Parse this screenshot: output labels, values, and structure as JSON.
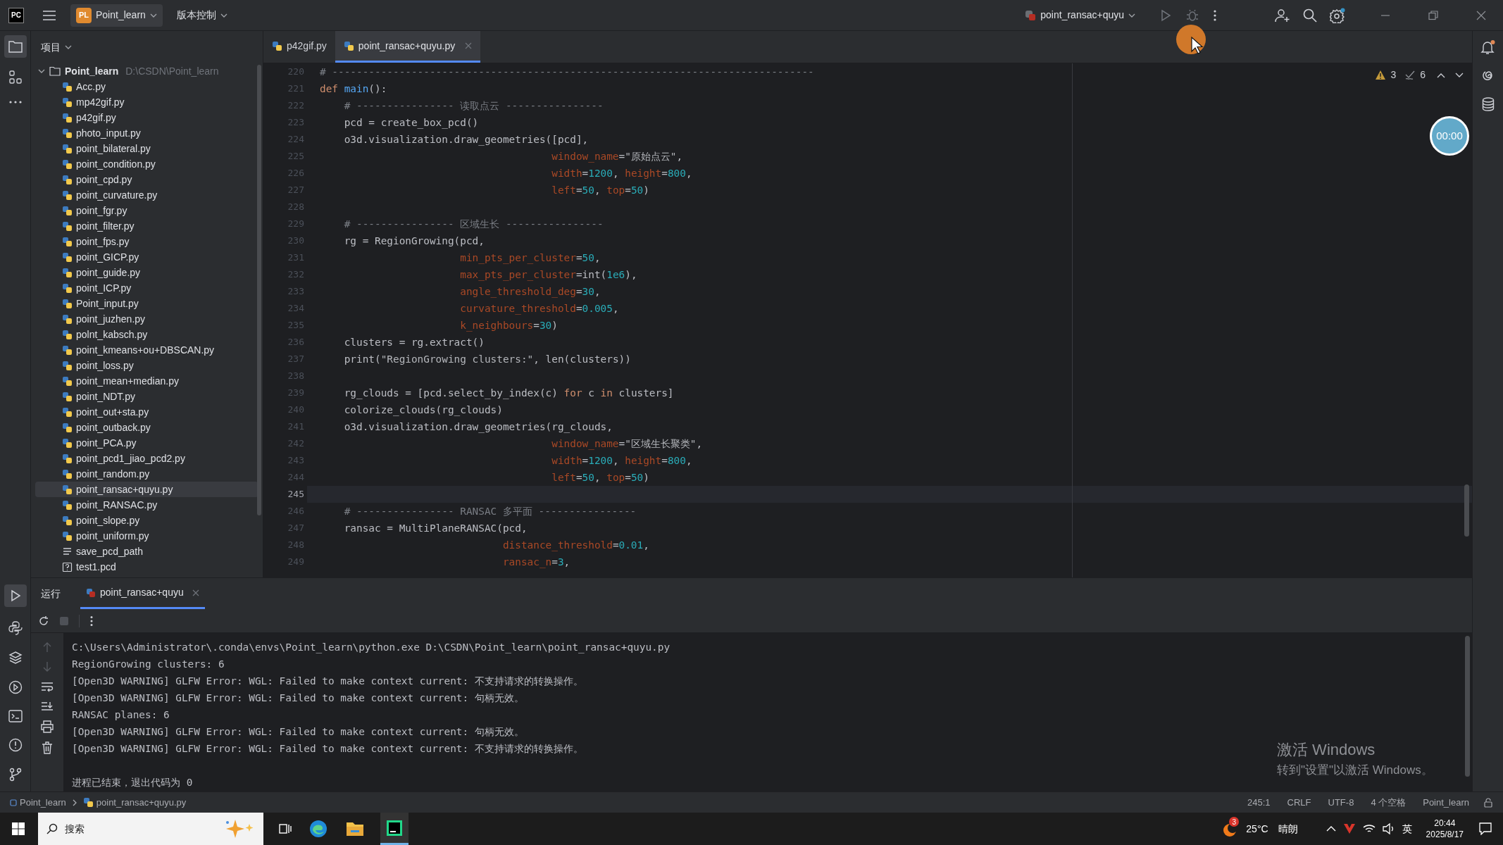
{
  "title_bar": {
    "app_logo": "PC",
    "project": {
      "badge": "PL",
      "name": "Point_learn"
    },
    "vcs_menu": "版本控制",
    "run_config": "point_ransac+quyu"
  },
  "project_panel": {
    "title": "项目",
    "root": {
      "name": "Point_learn",
      "path": "D:\\CSDN\\Point_learn",
      "expanded": true,
      "children": [
        {
          "name": "Acc.py",
          "kind": "python",
          "selected": false
        },
        {
          "name": "mp42gif.py",
          "kind": "python",
          "selected": false
        },
        {
          "name": "p42gif.py",
          "kind": "python",
          "selected": false
        },
        {
          "name": "photo_input.py",
          "kind": "python",
          "selected": false
        },
        {
          "name": "point_bilateral.py",
          "kind": "python",
          "selected": false
        },
        {
          "name": "point_condition.py",
          "kind": "python",
          "selected": false
        },
        {
          "name": "point_cpd.py",
          "kind": "python",
          "selected": false
        },
        {
          "name": "point_curvature.py",
          "kind": "python",
          "selected": false
        },
        {
          "name": "point_fgr.py",
          "kind": "python",
          "selected": false
        },
        {
          "name": "point_filter.py",
          "kind": "python",
          "selected": false
        },
        {
          "name": "point_fps.py",
          "kind": "python",
          "selected": false
        },
        {
          "name": "point_GICP.py",
          "kind": "python",
          "selected": false
        },
        {
          "name": "point_guide.py",
          "kind": "python",
          "selected": false
        },
        {
          "name": "point_ICP.py",
          "kind": "python",
          "selected": false
        },
        {
          "name": "Point_input.py",
          "kind": "python",
          "selected": false
        },
        {
          "name": "point_juzhen.py",
          "kind": "python",
          "selected": false
        },
        {
          "name": "polnt_kabsch.py",
          "kind": "python",
          "selected": false
        },
        {
          "name": "point_kmeans+ou+DBSCAN.py",
          "kind": "python",
          "selected": false
        },
        {
          "name": "point_loss.py",
          "kind": "python",
          "selected": false
        },
        {
          "name": "point_mean+median.py",
          "kind": "python",
          "selected": false
        },
        {
          "name": "point_NDT.py",
          "kind": "python",
          "selected": false
        },
        {
          "name": "point_out+sta.py",
          "kind": "python",
          "selected": false
        },
        {
          "name": "point_outback.py",
          "kind": "python",
          "selected": false
        },
        {
          "name": "point_PCA.py",
          "kind": "python",
          "selected": false
        },
        {
          "name": "point_pcd1_jiao_pcd2.py",
          "kind": "python",
          "selected": false
        },
        {
          "name": "point_random.py",
          "kind": "python",
          "selected": false
        },
        {
          "name": "point_ransac+quyu.py",
          "kind": "python",
          "selected": true
        },
        {
          "name": "point_RANSAC.py",
          "kind": "python",
          "selected": false
        },
        {
          "name": "point_slope.py",
          "kind": "python",
          "selected": false
        },
        {
          "name": "point_uniform.py",
          "kind": "python",
          "selected": false
        },
        {
          "name": "save_pcd_path",
          "kind": "text",
          "selected": false
        },
        {
          "name": "test1.pcd",
          "kind": "unknown",
          "selected": false
        }
      ]
    }
  },
  "editor": {
    "tabs": [
      {
        "label": "p42gif.py",
        "selected": false
      },
      {
        "label": "point_ransac+quyu.py",
        "selected": true
      }
    ],
    "inspections": {
      "warnings": "3",
      "weak_warnings": "6"
    },
    "lines": [
      {
        "number": "220",
        "current": false,
        "tokens": [
          {
            "kind": "comment",
            "text": "# -------------------------------------------------------------------------------"
          }
        ]
      },
      {
        "number": "221",
        "current": false,
        "tokens": [
          {
            "kind": "keyword",
            "text": "def"
          },
          {
            "kind": "function",
            "text": " main"
          },
          {
            "kind": "plain",
            "text": "():"
          }
        ]
      },
      {
        "number": "222",
        "current": false,
        "tokens": [
          {
            "kind": "comment",
            "text": "    # ---------------- 读取点云 ----------------"
          }
        ]
      },
      {
        "number": "223",
        "current": false,
        "tokens": [
          {
            "kind": "plain",
            "text": "    pcd = create_box_pcd()"
          }
        ]
      },
      {
        "number": "224",
        "current": false,
        "tokens": [
          {
            "kind": "plain",
            "text": "    o3d.visualization.draw_geometries([pcd],"
          }
        ]
      },
      {
        "number": "225",
        "current": false,
        "tokens": [
          {
            "kind": "param",
            "text": "                                      window_name"
          },
          {
            "kind": "plain",
            "text": "="
          },
          {
            "kind": "string",
            "text": "\"原始点云\""
          },
          {
            "kind": "plain",
            "text": ","
          }
        ]
      },
      {
        "number": "226",
        "current": false,
        "tokens": [
          {
            "kind": "param",
            "text": "                                      width"
          },
          {
            "kind": "plain",
            "text": "="
          },
          {
            "kind": "number",
            "text": "1200"
          },
          {
            "kind": "plain",
            "text": ", "
          },
          {
            "kind": "param",
            "text": "height"
          },
          {
            "kind": "plain",
            "text": "="
          },
          {
            "kind": "number",
            "text": "800"
          },
          {
            "kind": "plain",
            "text": ","
          }
        ]
      },
      {
        "number": "227",
        "current": false,
        "tokens": [
          {
            "kind": "param",
            "text": "                                      left"
          },
          {
            "kind": "plain",
            "text": "="
          },
          {
            "kind": "number",
            "text": "50"
          },
          {
            "kind": "plain",
            "text": ", "
          },
          {
            "kind": "param",
            "text": "top"
          },
          {
            "kind": "plain",
            "text": "="
          },
          {
            "kind": "number",
            "text": "50"
          },
          {
            "kind": "plain",
            "text": ")"
          }
        ]
      },
      {
        "number": "228",
        "current": false
      },
      {
        "number": "229",
        "current": false,
        "tokens": [
          {
            "kind": "comment",
            "text": "    # ---------------- 区域生长 ----------------"
          }
        ]
      },
      {
        "number": "230",
        "current": false,
        "tokens": [
          {
            "kind": "plain",
            "text": "    rg = RegionGrowing(pcd,"
          }
        ]
      },
      {
        "number": "231",
        "current": false,
        "tokens": [
          {
            "kind": "param",
            "text": "                       min_pts_per_cluster"
          },
          {
            "kind": "plain",
            "text": "="
          },
          {
            "kind": "number",
            "text": "50"
          },
          {
            "kind": "plain",
            "text": ","
          }
        ]
      },
      {
        "number": "232",
        "current": false,
        "tokens": [
          {
            "kind": "param",
            "text": "                       max_pts_per_cluster"
          },
          {
            "kind": "plain",
            "text": "=int("
          },
          {
            "kind": "number",
            "text": "1e6"
          },
          {
            "kind": "plain",
            "text": "),"
          }
        ]
      },
      {
        "number": "233",
        "current": false,
        "tokens": [
          {
            "kind": "param",
            "text": "                       angle_threshold_deg"
          },
          {
            "kind": "plain",
            "text": "="
          },
          {
            "kind": "number",
            "text": "30"
          },
          {
            "kind": "plain",
            "text": ","
          }
        ]
      },
      {
        "number": "234",
        "current": false,
        "tokens": [
          {
            "kind": "param",
            "text": "                       curvature_threshold"
          },
          {
            "kind": "plain",
            "text": "="
          },
          {
            "kind": "number",
            "text": "0.005"
          },
          {
            "kind": "plain",
            "text": ","
          }
        ]
      },
      {
        "number": "235",
        "current": false,
        "tokens": [
          {
            "kind": "param",
            "text": "                       k_neighbours"
          },
          {
            "kind": "plain",
            "text": "="
          },
          {
            "kind": "number",
            "text": "30"
          },
          {
            "kind": "plain",
            "text": ")"
          }
        ]
      },
      {
        "number": "236",
        "current": false,
        "tokens": [
          {
            "kind": "plain",
            "text": "    clusters = rg.extract()"
          }
        ]
      },
      {
        "number": "237",
        "current": false,
        "tokens": [
          {
            "kind": "plain",
            "text": "    print("
          },
          {
            "kind": "string",
            "text": "\"RegionGrowing clusters:\""
          },
          {
            "kind": "plain",
            "text": ", len(clusters))"
          }
        ]
      },
      {
        "number": "238",
        "current": false
      },
      {
        "number": "239",
        "current": false,
        "tokens": [
          {
            "kind": "plain",
            "text": "    rg_clouds = [pcd.select_by_index(c) "
          },
          {
            "kind": "keyword",
            "text": "for"
          },
          {
            "kind": "plain",
            "text": " c "
          },
          {
            "kind": "keyword",
            "text": "in"
          },
          {
            "kind": "plain",
            "text": " clusters]"
          }
        ]
      },
      {
        "number": "240",
        "current": false,
        "tokens": [
          {
            "kind": "plain",
            "text": "    colorize_clouds(rg_clouds)"
          }
        ]
      },
      {
        "number": "241",
        "current": false,
        "tokens": [
          {
            "kind": "plain",
            "text": "    o3d.visualization.draw_geometries(rg_clouds,"
          }
        ]
      },
      {
        "number": "242",
        "current": false,
        "tokens": [
          {
            "kind": "param",
            "text": "                                      window_name"
          },
          {
            "kind": "plain",
            "text": "="
          },
          {
            "kind": "string",
            "text": "\"区域生长聚类\""
          },
          {
            "kind": "plain",
            "text": ","
          }
        ]
      },
      {
        "number": "243",
        "current": false,
        "tokens": [
          {
            "kind": "param",
            "text": "                                      width"
          },
          {
            "kind": "plain",
            "text": "="
          },
          {
            "kind": "number",
            "text": "1200"
          },
          {
            "kind": "plain",
            "text": ", "
          },
          {
            "kind": "param",
            "text": "height"
          },
          {
            "kind": "plain",
            "text": "="
          },
          {
            "kind": "number",
            "text": "800"
          },
          {
            "kind": "plain",
            "text": ","
          }
        ]
      },
      {
        "number": "244",
        "current": false,
        "tokens": [
          {
            "kind": "param",
            "text": "                                      left"
          },
          {
            "kind": "plain",
            "text": "="
          },
          {
            "kind": "number",
            "text": "50"
          },
          {
            "kind": "plain",
            "text": ", "
          },
          {
            "kind": "param",
            "text": "top"
          },
          {
            "kind": "plain",
            "text": "="
          },
          {
            "kind": "number",
            "text": "50"
          },
          {
            "kind": "plain",
            "text": ")"
          }
        ]
      },
      {
        "number": "245",
        "current": true
      },
      {
        "number": "246",
        "current": false,
        "tokens": [
          {
            "kind": "comment",
            "text": "    # ---------------- RANSAC 多平面 ----------------"
          }
        ]
      },
      {
        "number": "247",
        "current": false,
        "tokens": [
          {
            "kind": "plain",
            "text": "    ransac = MultiPlaneRANSAC(pcd,"
          }
        ]
      },
      {
        "number": "248",
        "current": false,
        "tokens": [
          {
            "kind": "param",
            "text": "                              distance_threshold"
          },
          {
            "kind": "plain",
            "text": "="
          },
          {
            "kind": "number",
            "text": "0.01"
          },
          {
            "kind": "plain",
            "text": ","
          }
        ]
      },
      {
        "number": "249",
        "current": false,
        "tokens": [
          {
            "kind": "param",
            "text": "                              ransac_n"
          },
          {
            "kind": "plain",
            "text": "="
          },
          {
            "kind": "number",
            "text": "3"
          },
          {
            "kind": "plain",
            "text": ","
          }
        ]
      }
    ]
  },
  "timer": "00:00",
  "run_panel": {
    "title": "运行",
    "tabs": [
      {
        "label": "point_ransac+quyu",
        "selected": true
      }
    ],
    "console": [
      {
        "kind": "command",
        "text": "C:\\Users\\Administrator\\.conda\\envs\\Point_learn\\python.exe D:\\CSDN\\Point_learn\\point_ransac+quyu.py"
      },
      {
        "kind": "output",
        "text": "RegionGrowing clusters: 6"
      },
      {
        "kind": "output",
        "text": "[Open3D WARNING] GLFW Error: WGL: Failed to make context current: 不支持请求的转换操作。"
      },
      {
        "kind": "output",
        "text": "[Open3D WARNING] GLFW Error: WGL: Failed to make context current: 句柄无效。"
      },
      {
        "kind": "output",
        "text": "RANSAC planes: 6"
      },
      {
        "kind": "output",
        "text": "[Open3D WARNING] GLFW Error: WGL: Failed to make context current: 句柄无效。"
      },
      {
        "kind": "output",
        "text": "[Open3D WARNING] GLFW Error: WGL: Failed to make context current: 不支持请求的转换操作。"
      },
      {
        "kind": "exit",
        "text": "进程已结束，退出代码为 0"
      }
    ]
  },
  "activation_notice": {
    "title": "激活 Windows",
    "subtitle": "转到\"设置\"以激活 Windows。"
  },
  "status_bar": {
    "breadcrumbs": [
      "Point_learn",
      "point_ransac+quyu.py"
    ],
    "position": "245:1",
    "line_separator": "CRLF",
    "encoding": "UTF-8",
    "indent": "4 个空格",
    "interpreter": "Point_learn"
  },
  "taskbar": {
    "search_placeholder": "搜索",
    "weather": {
      "badge": "3",
      "temperature": "25°C",
      "condition": "晴朗"
    },
    "ime": "英",
    "time": "20:44",
    "date": "2025/8/17"
  }
}
